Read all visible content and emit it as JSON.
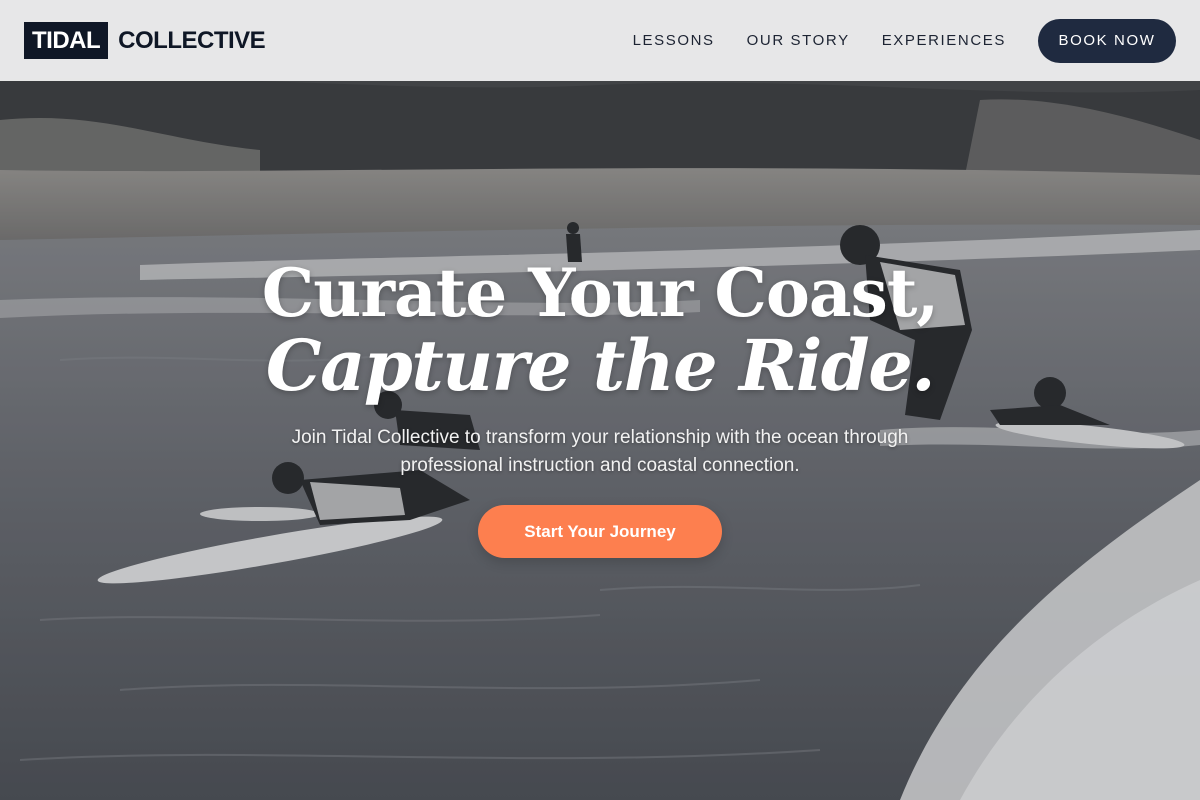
{
  "nav": {
    "logo_box": "TIDAL",
    "logo_text": "COLLECTIVE",
    "links": [
      "LESSONS",
      "OUR STORY",
      "EXPERIENCES"
    ],
    "book_label": "BOOK NOW"
  },
  "hero": {
    "headline_line1": "Curate Your Coast,",
    "headline_line2": "Capture the Ride.",
    "subtext": "Join Tidal Collective to transform your relationship with the ocean through professional instruction and coastal connection.",
    "cta_label": "Start Your Journey"
  },
  "colors": {
    "brand_dark": "#0f1726",
    "book_button": "#1f2a40",
    "cta_accent": "#fd7f4f",
    "navbar_bg": "#eeeeee"
  }
}
